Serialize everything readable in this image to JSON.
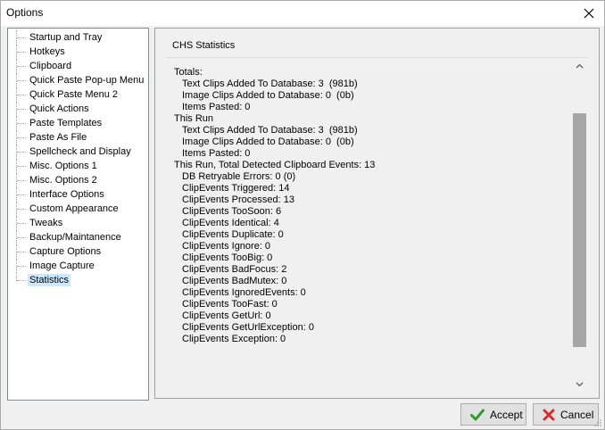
{
  "window": {
    "title": "Options"
  },
  "tree": {
    "items": [
      {
        "label": "Startup and Tray"
      },
      {
        "label": "Hotkeys"
      },
      {
        "label": "Clipboard"
      },
      {
        "label": "Quick Paste Pop-up Menu"
      },
      {
        "label": "Quick Paste Menu 2"
      },
      {
        "label": "Quick Actions"
      },
      {
        "label": "Paste Templates"
      },
      {
        "label": "Paste As File"
      },
      {
        "label": "Spellcheck and Display"
      },
      {
        "label": "Misc. Options 1"
      },
      {
        "label": "Misc. Options 2"
      },
      {
        "label": "Interface Options"
      },
      {
        "label": "Custom Appearance"
      },
      {
        "label": "Tweaks"
      },
      {
        "label": "Backup/Maintanence"
      },
      {
        "label": "Capture Options"
      },
      {
        "label": "Image Capture"
      },
      {
        "label": "Statistics"
      }
    ],
    "selected": "Statistics"
  },
  "panel": {
    "title": "CHS Statistics",
    "lines": [
      {
        "text": "Totals:",
        "indent": false
      },
      {
        "text": "Text Clips Added To Database: 3  (981b)",
        "indent": true
      },
      {
        "text": "Image Clips Added to Database: 0  (0b)",
        "indent": true
      },
      {
        "text": "Items Pasted: 0",
        "indent": true
      },
      {
        "text": "This Run",
        "indent": false
      },
      {
        "text": "Text Clips Added To Database: 3  (981b)",
        "indent": true
      },
      {
        "text": "Image Clips Added to Database: 0  (0b)",
        "indent": true
      },
      {
        "text": "Items Pasted: 0",
        "indent": true
      },
      {
        "text": "This Run, Total Detected Clipboard Events: 13",
        "indent": false
      },
      {
        "text": "DB Retryable Errors: 0 (0)",
        "indent": true
      },
      {
        "text": "ClipEvents Triggered: 14",
        "indent": true
      },
      {
        "text": "ClipEvents Processed: 13",
        "indent": true
      },
      {
        "text": "ClipEvents TooSoon: 6",
        "indent": true
      },
      {
        "text": "ClipEvents Identical: 4",
        "indent": true
      },
      {
        "text": "ClipEvents Duplicate: 0",
        "indent": true
      },
      {
        "text": "ClipEvents Ignore: 0",
        "indent": true
      },
      {
        "text": "ClipEvents TooBig: 0",
        "indent": true
      },
      {
        "text": "ClipEvents BadFocus: 2",
        "indent": true
      },
      {
        "text": "ClipEvents BadMutex: 0",
        "indent": true
      },
      {
        "text": "ClipEvents IgnoredEvents: 0",
        "indent": true
      },
      {
        "text": "ClipEvents TooFast: 0",
        "indent": true
      },
      {
        "text": "ClipEvents GetUrl: 0",
        "indent": true
      },
      {
        "text": "ClipEvents GetUrlException: 0",
        "indent": true
      },
      {
        "text": "ClipEvents Exception: 0",
        "indent": true
      }
    ]
  },
  "buttons": {
    "accept_label": "Accept",
    "cancel_label": "Cancel"
  },
  "icons": {
    "close": "close-icon",
    "accept": "checkmark-icon",
    "cancel": "x-icon",
    "scroll_up": "chevron-up-icon",
    "scroll_down": "chevron-down-icon"
  },
  "colors": {
    "selection": "#cce8ff",
    "accept_icon": "#2e9e2e",
    "cancel_icon": "#d32f2f",
    "scroll_thumb": "#a6a6a6"
  }
}
